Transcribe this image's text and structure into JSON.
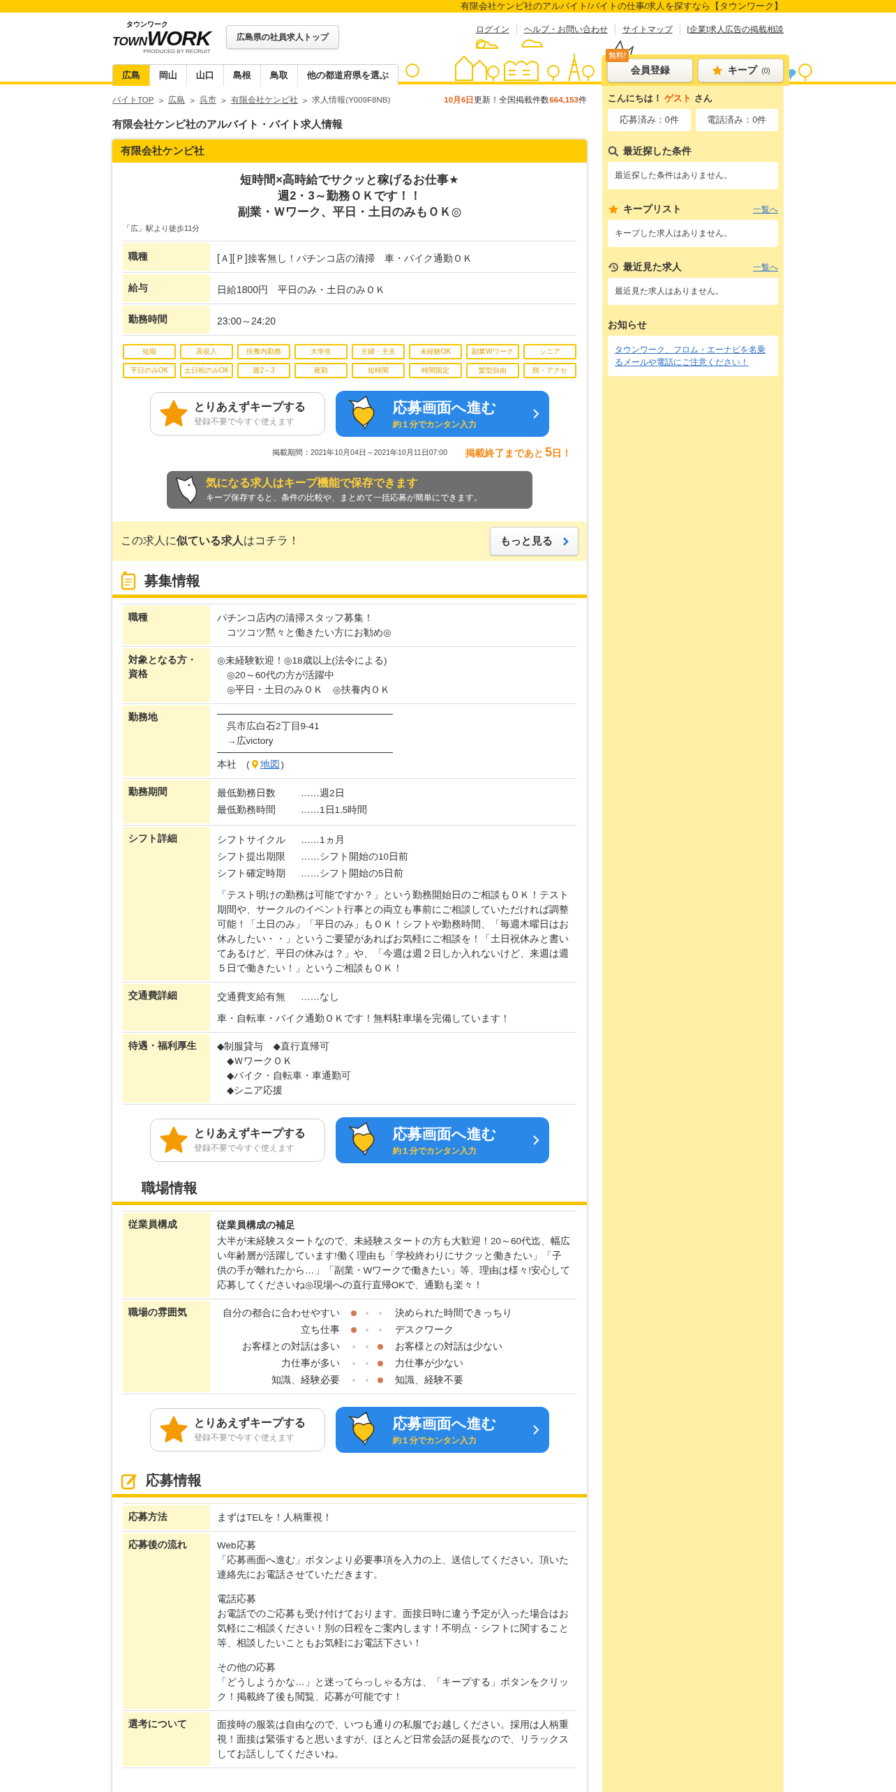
{
  "top_strip": "有限会社ケンビ社のアルバイト/バイトの仕事/求人を探すなら【タウンワーク】",
  "header": {
    "logo": {
      "kana": "タウンワーク",
      "town": "TOWN",
      "work": "WORK",
      "produced": "PRODUCED BY RECRUIT"
    },
    "top_button": "広島県の社員求人トップ",
    "links": [
      "ログイン",
      "ヘルプ・お問い合わせ",
      "サイトマップ",
      "[企業]求人広告の掲載相談"
    ],
    "prefectures": [
      {
        "label": "広島",
        "selected": true
      },
      {
        "label": "岡山",
        "selected": false
      },
      {
        "label": "山口",
        "selected": false
      },
      {
        "label": "島根",
        "selected": false
      },
      {
        "label": "鳥取",
        "selected": false
      },
      {
        "label": "他の都道府県を選ぶ",
        "selected": false
      }
    ],
    "free_badge": "無料!",
    "member_button": "会員登録",
    "keep_button": "キープ",
    "keep_count": "(0)"
  },
  "breadcrumb": {
    "separator": ">",
    "items": [
      {
        "label": "バイトTOP",
        "link": true
      },
      {
        "label": "広島",
        "link": true
      },
      {
        "label": "呉市",
        "link": true
      },
      {
        "label": "有限会社ケンビ社",
        "link": true
      },
      {
        "label": "求人情報(Y009F8NB)",
        "link": false
      }
    ]
  },
  "update": {
    "date": "10月6日",
    "text": "更新！全国掲載件数",
    "count": "664,153",
    "unit": "件"
  },
  "page_title": "有限会社ケンビ社のアルバイト・バイト求人情報",
  "job": {
    "company": "有限会社ケンビ社",
    "catch": [
      "短時間×高時給でサクッと稼げるお仕事★",
      "週2・3～勤務ＯＫです！！",
      "副業・Ｗワーク、平日・土日のみもＯＫ◎"
    ],
    "access": "「広」駅より徒歩11分",
    "summary": [
      {
        "label": "職種",
        "value": "[Ａ][Ｐ]接客無し！パチンコ店の清掃　車・バイク通勤ＯＫ"
      },
      {
        "label": "給与",
        "value": "日給1800円　平日のみ・土日のみＯＫ"
      },
      {
        "label": "勤務時間",
        "value": "23:00～24:20"
      }
    ],
    "tags": [
      "短期",
      "高収入",
      "扶養内勤務",
      "大学生",
      "主婦・主夫",
      "未経験OK",
      "副業Wワーク",
      "シニア",
      "平日のみOK",
      "土日祝のみOK",
      "週2～3",
      "夜勤",
      "短時間",
      "時間固定",
      "髪型自由",
      "髭・アクセ"
    ],
    "period": "掲載期間：2021年10月04日～2021年10月11日07:00",
    "deadline": {
      "before": "掲載終了まであと",
      "days": "5",
      "after": "日！"
    },
    "keep_promo": {
      "title": "気になる求人はキープ機能で保存できます",
      "text": "キープ保存すると、条件の比較や、まとめて一括応募が簡単にできます。"
    },
    "similar": {
      "text": "この求人に**似ている求人**はコチラ！",
      "button": "もっと見る"
    }
  },
  "cta": [
    {
      "keep_title": "とりあえずキープする",
      "keep_sub": "登録不要で今すぐ使えます",
      "apply_title": "応募画面へ進む",
      "apply_sub": "約１分でカンタン入力"
    },
    {
      "keep_title": "とりあえずキープする",
      "keep_sub": "登録不要で今すぐ使えます",
      "apply_title": "応募画面へ進む",
      "apply_sub": "約１分でカンタン入力"
    },
    {
      "keep_title": "とりあえずキープする",
      "keep_sub": "登録不要で今すぐ使えます",
      "apply_title": "応募画面へ進む",
      "apply_sub": "約１分でカンタン入力"
    }
  ],
  "sections": [
    {
      "title": "募集情報",
      "rows": [
        {
          "label": "職種",
          "kind": "lines",
          "lines": [
            "パチンコ店内の清掃スタッフ募集！",
            "　コツコツ黙々と働きたい方にお勧め◎"
          ]
        },
        {
          "label": "対象となる方・資格",
          "kind": "lines",
          "lines": [
            "◎未経験歓迎！◎18歳以上(法令による)",
            "　◎20～60代の方が活躍中",
            "　◎平日・土日のみＯＫ　◎扶養内ＯＫ"
          ]
        },
        {
          "label": "勤務地",
          "kind": "address",
          "lines": [
            "　呉市広白石2丁目9-41",
            "　→広victory"
          ],
          "office": "本社　(",
          "map_link": "地図",
          "close": ")"
        },
        {
          "label": "勤務期間",
          "kind": "pairs",
          "pairs": [
            {
              "key": "最低勤務日数",
              "value": "……週2日"
            },
            {
              "key": "最低勤務時間",
              "value": "……1日1.5時間"
            }
          ]
        },
        {
          "label": "シフト詳細",
          "kind": "pairs",
          "pairs": [
            {
              "key": "シフトサイクル",
              "value": "……1ヵ月"
            },
            {
              "key": "シフト提出期限",
              "value": "……シフト開始の10日前"
            },
            {
              "key": "シフト確定時期",
              "value": "……シフト開始の5日前"
            }
          ],
          "paragraph": "「テスト明けの勤務は可能ですか？」という勤務開始日のご相談もＯＫ！テスト期間や、サークルのイベント行事との両立も事前にご相談していただければ調整可能！「土日のみ」「平日のみ」もＯＫ！シフトや勤務時間、「毎週木曜日はお休みしたい・・」というご要望があればお気軽にご相談を！「土日祝休みと書いてあるけど、平日の休みは？」や、「今週は週２日しか入れないけど、来週は週５日で働きたい！」というご相談もＯＫ！"
        },
        {
          "label": "交通費詳細",
          "kind": "pairs",
          "pairs": [
            {
              "key": "交通費支給有無",
              "value": "……なし"
            }
          ],
          "paragraph": "車・自転車・バイク通勤ＯＫです！無料駐車場を完備しています！"
        },
        {
          "label": "待遇・福利厚生",
          "kind": "lines",
          "lines": [
            "◆制服貸与　◆直行直帰可",
            "　◆ＷワークＯＫ",
            "　◆バイク・自転車・車通勤可",
            "　◆シニア応援"
          ]
        }
      ]
    },
    {
      "title": "職場情報",
      "rows": [
        {
          "label": "従業員構成",
          "kind": "subtitled",
          "subtitle": "従業員構成の補足",
          "paragraph": "大半が未経験スタートなので、未経験スタートの方も大歓迎！20～60代迄、幅広い年齢層が活躍しています!働く理由も「学校終わりにサクッと働きたい」「子供の手が離れたから…」「副業・Wワークで働きたい」等、理由は様々!安心して応募してくださいね◎現場への直行直帰OKで、通勤も楽々！"
        },
        {
          "label": "職場の雰囲気",
          "kind": "atmosphere",
          "scales": [
            {
              "left": "自分の都合に合わせやすい",
              "right": "決められた時間できっちり",
              "dots": [
                {
                  "selected": true
                },
                {
                  "selected": false
                },
                {
                  "selected": false
                }
              ]
            },
            {
              "left": "立ち仕事",
              "right": "デスクワーク",
              "dots": [
                {
                  "selected": true
                },
                {
                  "selected": false
                },
                {
                  "selected": false
                }
              ]
            },
            {
              "left": "お客様との対話は多い",
              "right": "お客様との対話は少ない",
              "dots": [
                {
                  "selected": false
                },
                {
                  "selected": false
                },
                {
                  "selected": true
                }
              ]
            },
            {
              "left": "力仕事が多い",
              "right": "力仕事が少ない",
              "dots": [
                {
                  "selected": false
                },
                {
                  "selected": false
                },
                {
                  "selected": true
                }
              ]
            },
            {
              "left": "知識、経験必要",
              "right": "知識、経験不要",
              "dots": [
                {
                  "selected": false
                },
                {
                  "selected": false
                },
                {
                  "selected": true
                }
              ]
            }
          ]
        }
      ]
    },
    {
      "title": "応募情報",
      "rows": [
        {
          "label": "応募方法",
          "kind": "lines",
          "lines": [
            "まずはTELを！人柄重視！"
          ]
        },
        {
          "label": "応募後の流れ",
          "kind": "blocks",
          "blocks": [
            {
              "heading": "Web応募",
              "text": "「応募画面へ進む」ボタンより必要事項を入力の上、送信してください。頂いた連絡先にお電話させていただきます。"
            },
            {
              "heading": "電話応募",
              "text": "お電話でのご応募も受け付けております。面接日時に違う予定が入った場合はお気軽にご相談ください！別の日程をご案内します！不明点・シフトに関すること等、相談したいこともお気軽にお電話下さい！"
            },
            {
              "heading": "その他の応募",
              "text": "「どうしようかな…」と迷ってらっしゃる方は、「キープする」ボタンをクリック！掲載終了後も閲覧、応募が可能です！"
            }
          ]
        },
        {
          "label": "選考について",
          "kind": "lines",
          "lines": [
            "面接時の服装は自由なので、いつも通りの私服でお越しください。採用は人柄重視！面接は緊張すると思いますが、ほとんど日常会話の延長なので、リラックスしてお話ししてくださいね。"
          ]
        }
      ]
    }
  ],
  "sidebar": {
    "greeting": {
      "before": "こんにちは！",
      "name": "ゲスト",
      "after": "さん"
    },
    "counters": [
      "応募済み：0件",
      "電話済み：0件"
    ],
    "panels": [
      {
        "title": "最近探した条件",
        "message": "最近探した条件はありません。"
      },
      {
        "title": "キープリスト",
        "link": "一覧へ",
        "message": "キープした求人はありません。"
      },
      {
        "title": "最近見た求人",
        "link": "一覧へ",
        "message": "最近見た求人はありません。"
      },
      {
        "title": "お知らせ",
        "notice": "タウンワーク、フロム・エーナビを名乗るメールや電話にご注意ください！"
      }
    ]
  }
}
